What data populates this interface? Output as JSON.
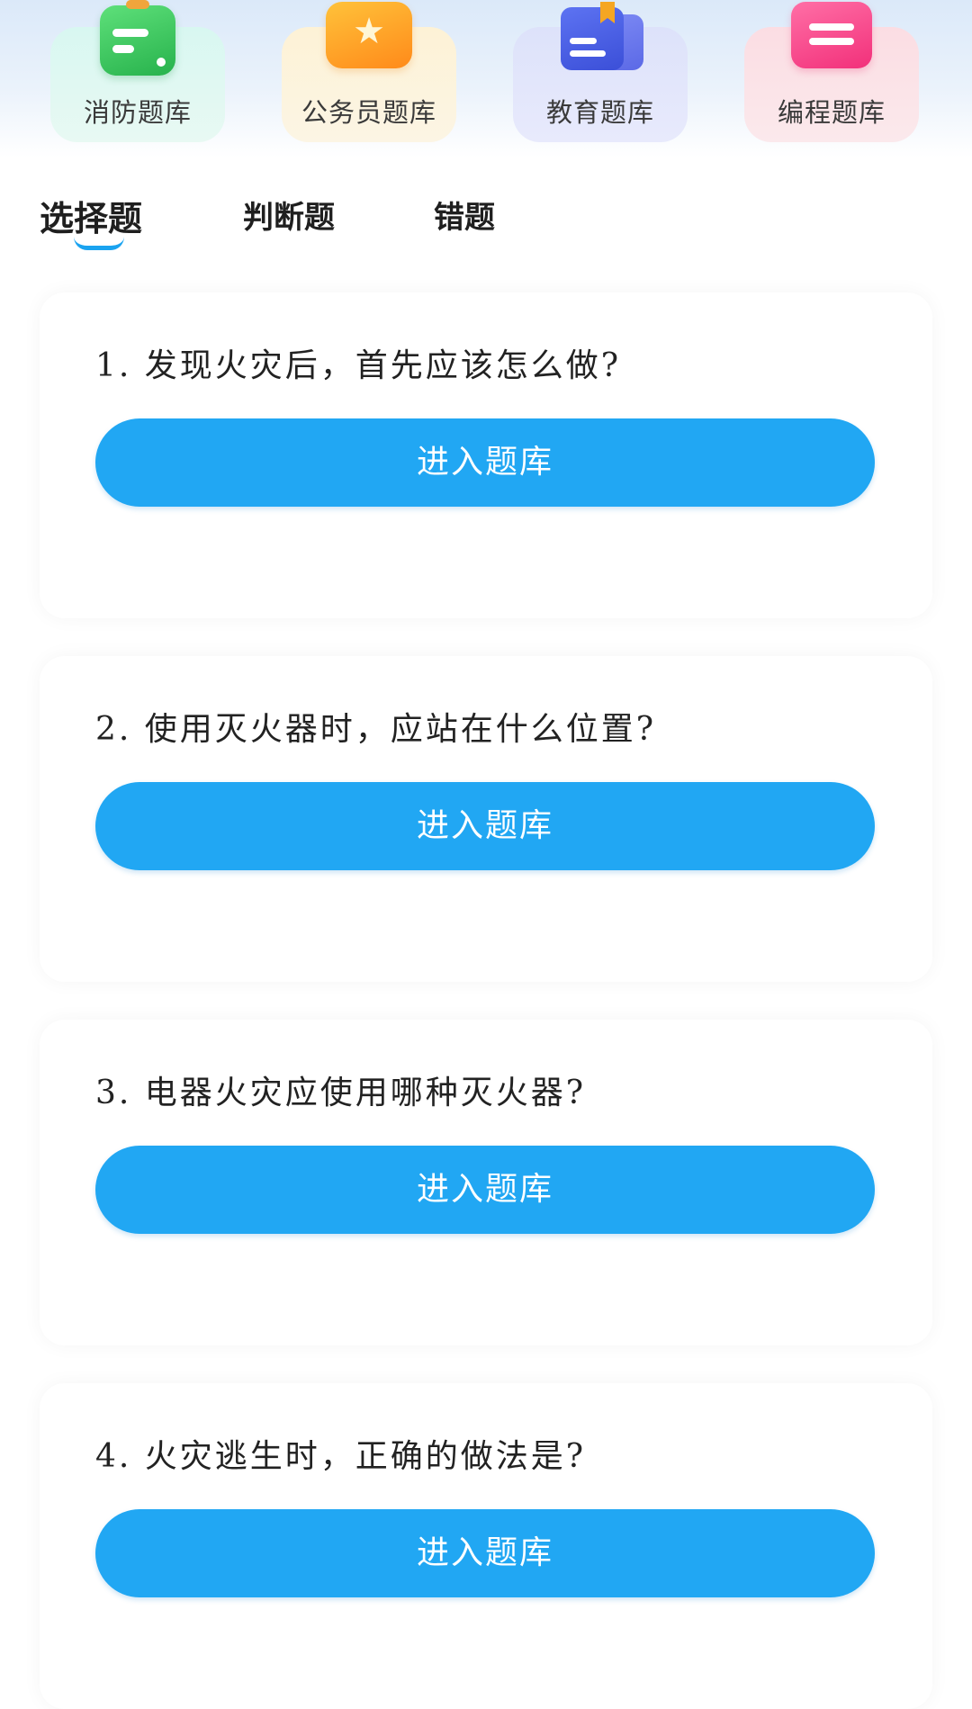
{
  "categories": [
    {
      "label": "消防题库",
      "icon": "green-clipboard-icon"
    },
    {
      "label": "公务员题库",
      "icon": "orange-star-icon"
    },
    {
      "label": "教育题库",
      "icon": "blue-book-icon"
    },
    {
      "label": "编程题库",
      "icon": "pink-list-icon"
    }
  ],
  "tabs": [
    {
      "label": "选择题",
      "active": true
    },
    {
      "label": "判断题",
      "active": false
    },
    {
      "label": "错题",
      "active": false
    }
  ],
  "questions": [
    {
      "text": "1. 发现火灾后，首先应该怎么做?",
      "button": "进入题库"
    },
    {
      "text": "2. 使用灭火器时，应站在什么位置?",
      "button": "进入题库"
    },
    {
      "text": "3. 电器火灾应使用哪种灭火器?",
      "button": "进入题库"
    },
    {
      "text": "4. 火灾逃生时，正确的做法是?",
      "button": "进入题库"
    }
  ],
  "colors": {
    "accent": "#21a7f3",
    "tab_indicator": "#1aa3f0"
  }
}
